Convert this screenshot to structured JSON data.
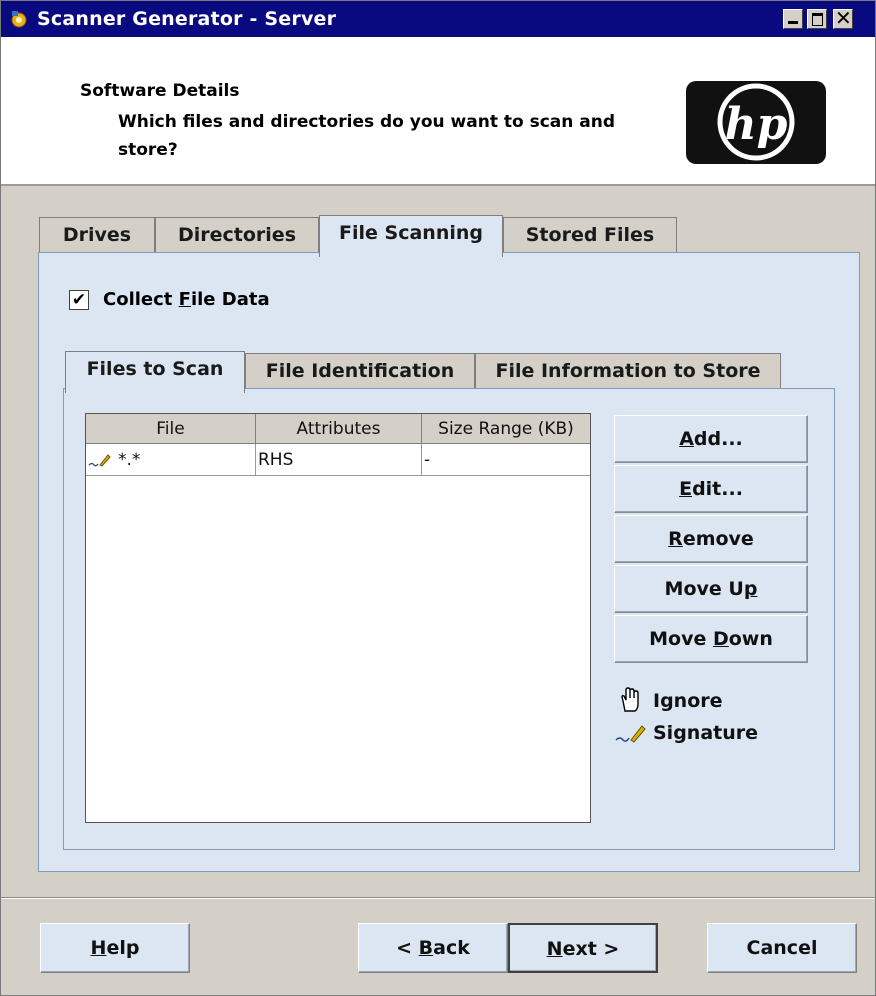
{
  "window": {
    "title": "Scanner Generator - Server",
    "controls": [
      "minimize",
      "maximize",
      "close"
    ]
  },
  "header": {
    "title": "Software Details",
    "subtitle": "Which files and directories do you want to scan and store?",
    "logo_text": "hp"
  },
  "tabs": [
    {
      "label": "Drives",
      "active": false
    },
    {
      "label": "Directories",
      "active": false
    },
    {
      "label": "File Scanning",
      "active": true
    },
    {
      "label": "Stored Files",
      "active": false
    }
  ],
  "collect": {
    "label": "Collect File Data",
    "checked": true
  },
  "subtabs": [
    {
      "label": "Files to Scan",
      "active": true
    },
    {
      "label": "File Identification",
      "active": false
    },
    {
      "label": "File Information to Store",
      "active": false
    }
  ],
  "table": {
    "columns": [
      "File",
      "Attributes",
      "Size Range (KB)"
    ],
    "rows": [
      {
        "icon": "signature-pen-icon",
        "file": "*.*",
        "attributes": "RHS",
        "size_range": "-"
      }
    ]
  },
  "actions": {
    "add": "Add...",
    "edit": "Edit...",
    "remove": "Remove",
    "move_up": "Move Up",
    "move_down": "Move Down"
  },
  "legend": [
    {
      "icon": "hand-icon",
      "label": "Ignore"
    },
    {
      "icon": "signature-pen-icon",
      "label": "Signature"
    }
  ],
  "footer": {
    "help": "Help",
    "back": "< Back",
    "next": "Next >",
    "cancel": "Cancel"
  },
  "colors": {
    "titlebar": "#0a0a80",
    "panel": "#dbe6f2",
    "window": "#d4d0c8"
  }
}
